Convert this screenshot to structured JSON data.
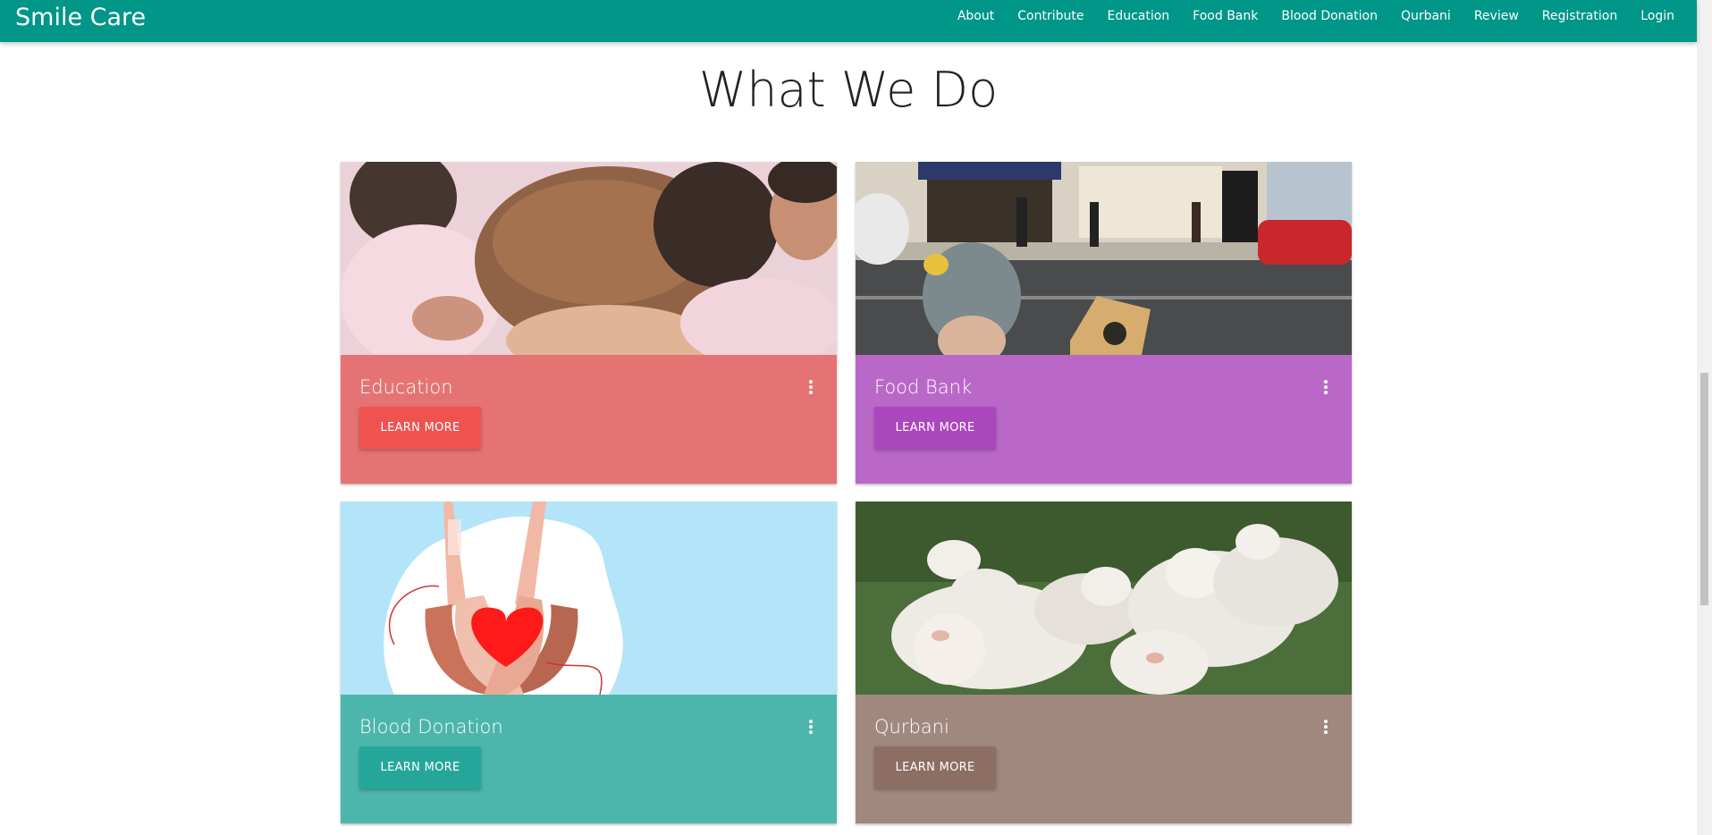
{
  "navbar": {
    "brand": "Smile Care",
    "links": [
      "About",
      "Contribute",
      "Education",
      "Food Bank",
      "Blood Donation",
      "Qurbani",
      "Review",
      "Registration",
      "Login"
    ],
    "color": "#009688"
  },
  "section": {
    "title": "What We Do"
  },
  "cards": [
    {
      "title": "Education",
      "button": "LEARN MORE",
      "body_color": "#e57373",
      "button_color": "#ef5350",
      "image": "children-praying-photo"
    },
    {
      "title": "Food Bank",
      "button": "LEARN MORE",
      "body_color": "#ba68c8",
      "button_color": "#ab47bc",
      "image": "street-person-photo"
    },
    {
      "title": "Blood Donation",
      "button": "LEARN MORE",
      "body_color": "#4db6ac",
      "button_color": "#26a69a",
      "image": "hands-heart-illustration"
    },
    {
      "title": "Qurbani",
      "button": "LEARN MORE",
      "body_color": "#a1887f",
      "button_color": "#8d6e63",
      "image": "sheep-photo"
    }
  ],
  "icons": {
    "card_menu": "more-vert-icon"
  }
}
